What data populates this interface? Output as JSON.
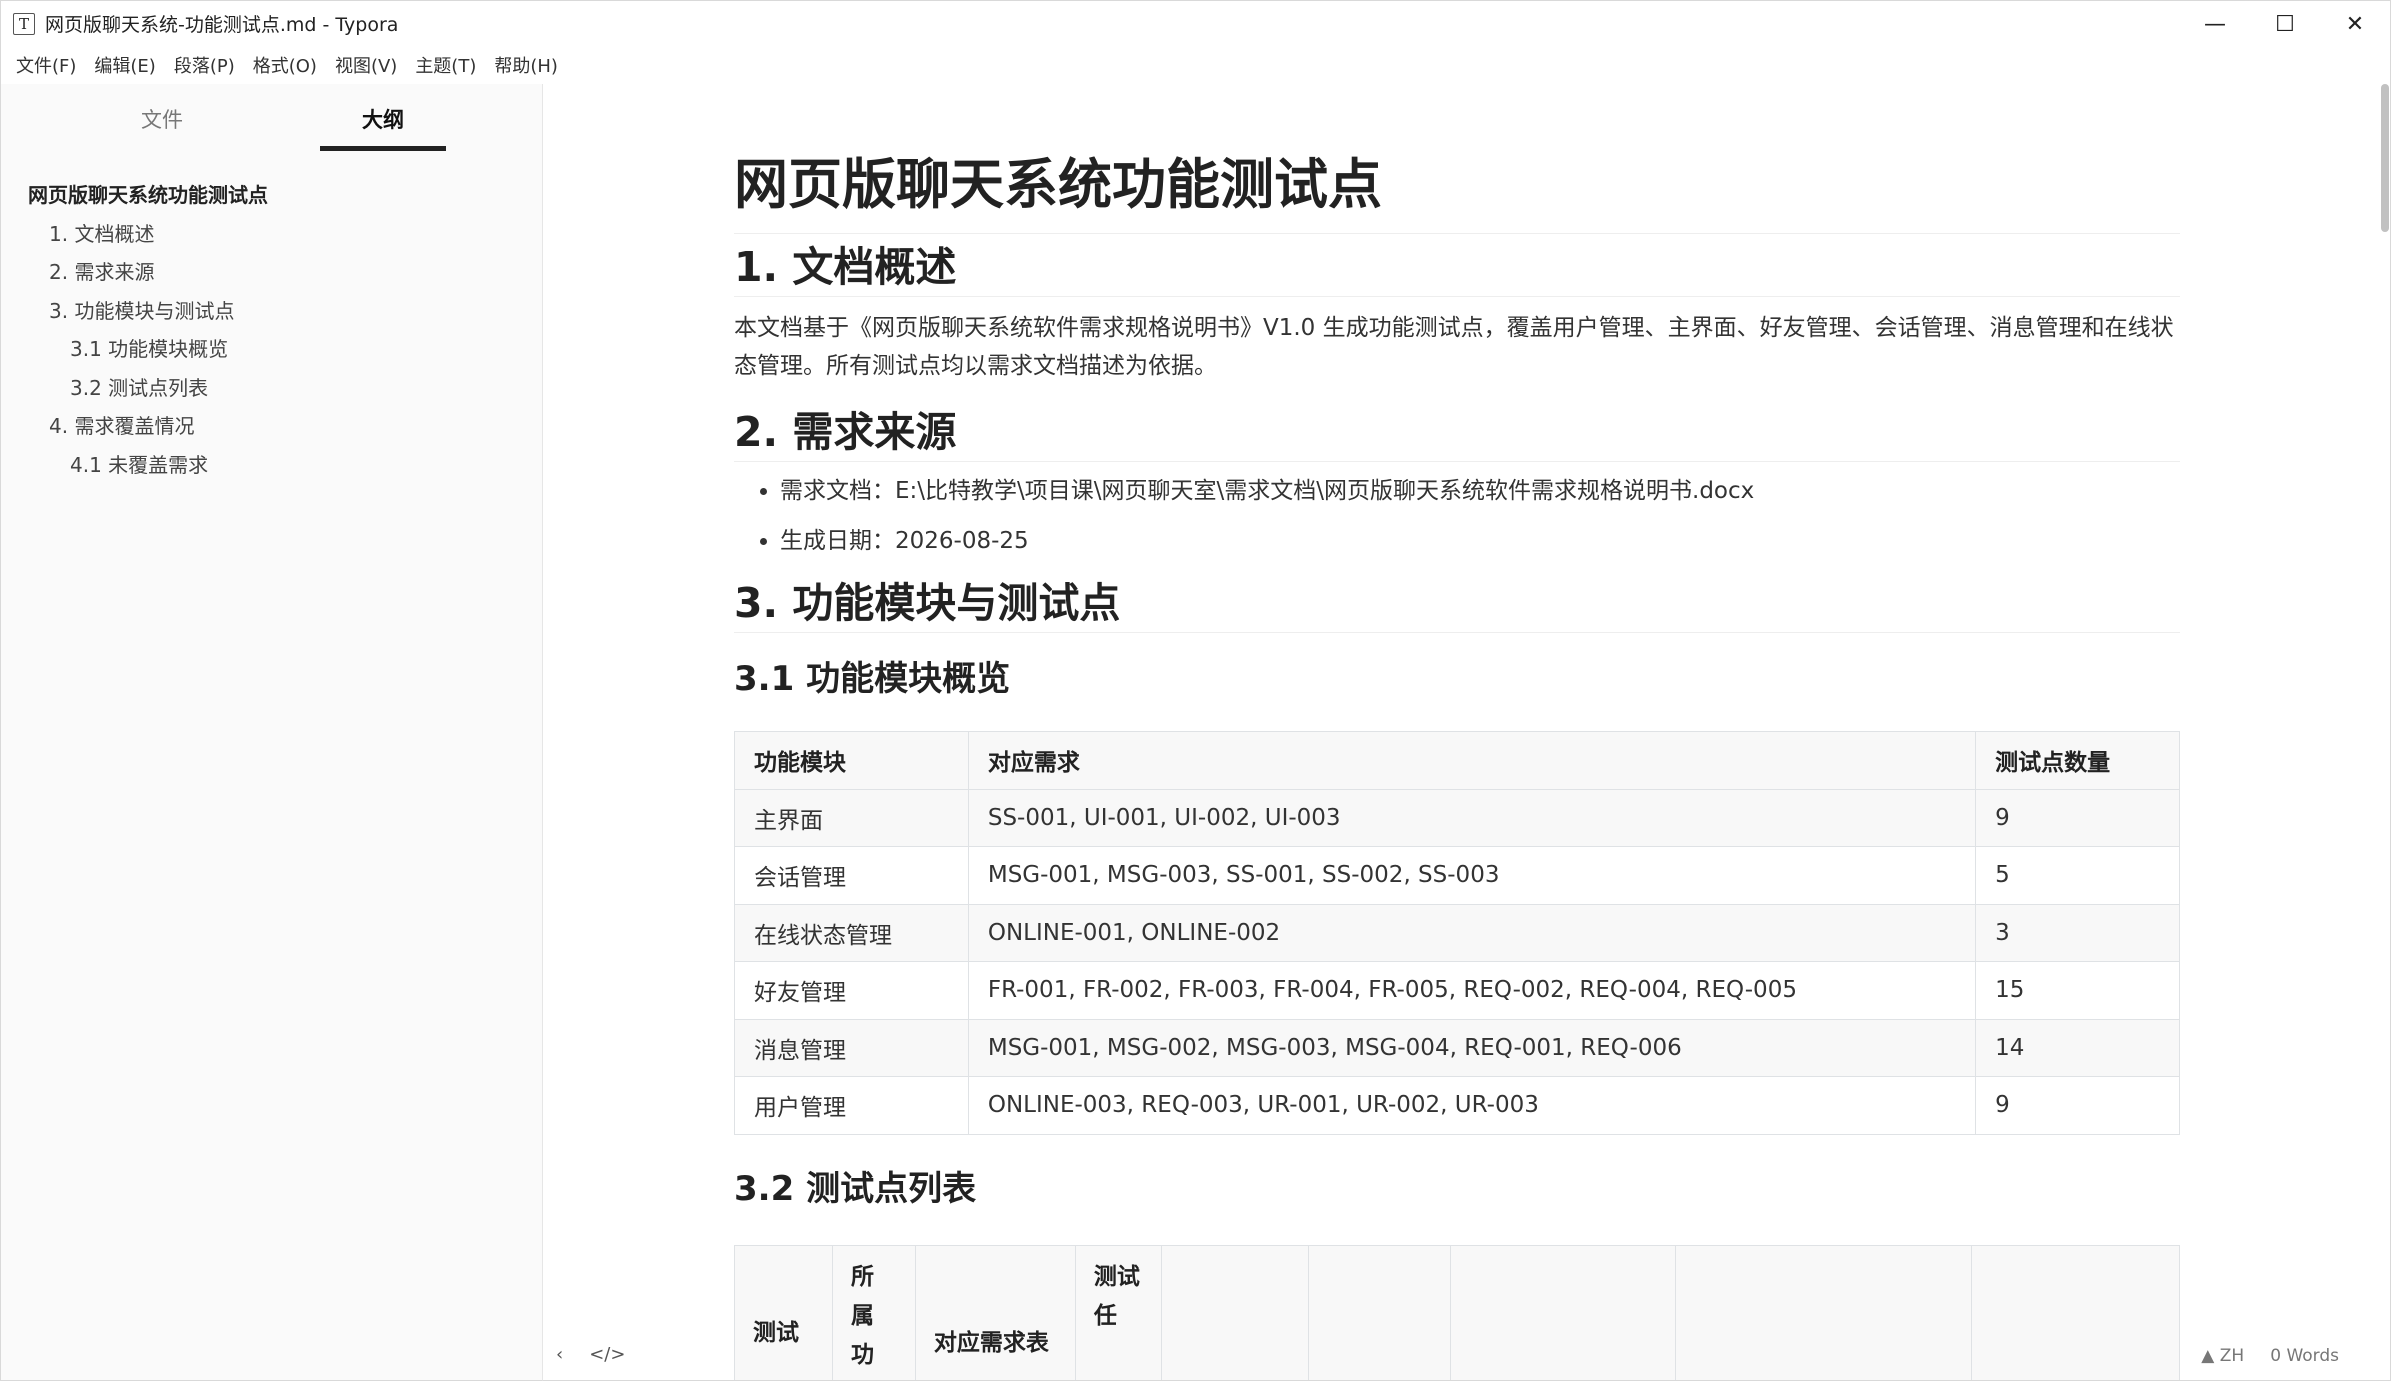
{
  "window": {
    "title": "网页版聊天系统-功能测试点.md - Typora",
    "icon_letter": "T",
    "controls": {
      "minimize": "—",
      "maximize": "☐",
      "close": "✕"
    }
  },
  "menu": [
    "文件(F)",
    "编辑(E)",
    "段落(P)",
    "格式(O)",
    "视图(V)",
    "主题(T)",
    "帮助(H)"
  ],
  "sidebar": {
    "tabs": {
      "files": "文件",
      "outline": "大纲"
    },
    "outline": [
      {
        "level": 1,
        "text": "网页版聊天系统功能测试点"
      },
      {
        "level": 2,
        "text": "1. 文档概述"
      },
      {
        "level": 2,
        "text": "2. 需求来源"
      },
      {
        "level": 2,
        "text": "3. 功能模块与测试点"
      },
      {
        "level": 3,
        "text": "3.1 功能模块概览"
      },
      {
        "level": 3,
        "text": "3.2 测试点列表"
      },
      {
        "level": 2,
        "text": "4. 需求覆盖情况"
      },
      {
        "level": 3,
        "text": "4.1 未覆盖需求"
      }
    ]
  },
  "doc": {
    "title": "网页版聊天系统功能测试点",
    "s1_heading": "1. 文档概述",
    "s1_para": "本文档基于《网页版聊天系统软件需求规格说明书》V1.0 生成功能测试点，覆盖用户管理、主界面、好友管理、会话管理、消息管理和在线状态管理。所有测试点均以需求文档描述为依据。",
    "s2_heading": "2. 需求来源",
    "s2_items": [
      "需求文档：E:\\比特教学\\项目课\\网页聊天室\\需求文档\\网页版聊天系统软件需求规格说明书.docx",
      "生成日期：2026-08-25"
    ],
    "s3_heading": "3. 功能模块与测试点",
    "s31_heading": "3.1 功能模块概览",
    "table1": {
      "headers": [
        "功能模块",
        "对应需求",
        "测试点数量"
      ],
      "rows": [
        [
          "主界面",
          "SS-001, UI-001, UI-002, UI-003",
          "9"
        ],
        [
          "会话管理",
          "MSG-001, MSG-003, SS-001, SS-002, SS-003",
          "5"
        ],
        [
          "在线状态管理",
          "ONLINE-001, ONLINE-002",
          "3"
        ],
        [
          "好友管理",
          "FR-001, FR-002, FR-003, FR-004, FR-005, REQ-002, REQ-004, REQ-005",
          "15"
        ],
        [
          "消息管理",
          "MSG-001, MSG-002, MSG-003, MSG-004, REQ-001, REQ-006",
          "14"
        ],
        [
          "用户管理",
          "ONLINE-003, REQ-003, UR-001, UR-002, UR-003",
          "9"
        ]
      ]
    },
    "s32_heading": "3.2 测试点列表",
    "table2_partial_headers": [
      "测试",
      "所属功",
      "对应需求表",
      "测试任"
    ]
  },
  "status": {
    "back": "‹",
    "source": "</>",
    "lang": "▲ ZH",
    "words": "0 Words"
  }
}
